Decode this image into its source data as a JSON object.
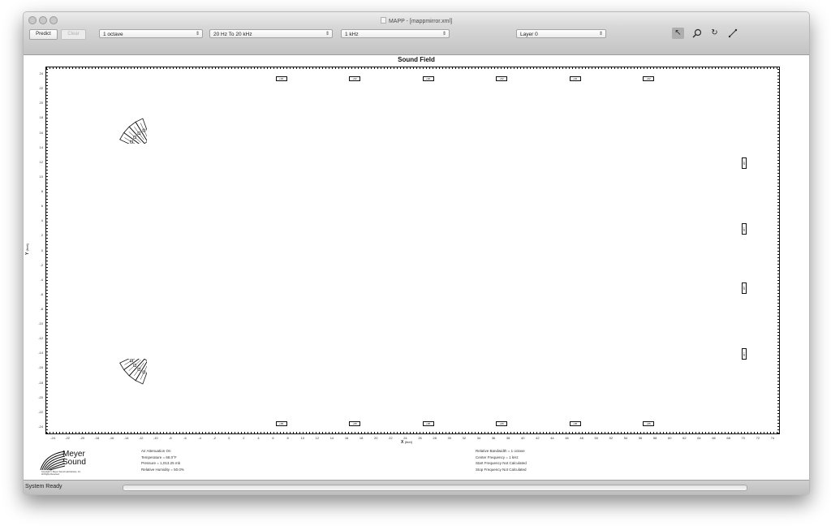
{
  "window": {
    "title": "MAPP - [mappmirror.xml]"
  },
  "toolbar": {
    "predict_label": "Predict",
    "clear_label": "Clear",
    "bandwidth_value": "1 octave",
    "range_value": "20 Hz To 20 kHz",
    "frequency_value": "1 kHz",
    "layer_value": "Layer 0",
    "tools": [
      "pointer-icon",
      "zoom-icon",
      "rotate-icon",
      "measure-icon"
    ]
  },
  "plot": {
    "title": "Sound Field",
    "x_axis_label": "X",
    "x_axis_unit": "(feet)",
    "y_axis_label": "Y",
    "y_axis_unit": "(feet)",
    "x_ticks": [
      "-24",
      "-22",
      "-20",
      "-18",
      "-16",
      "-14",
      "-12",
      "-10",
      "-8",
      "-6",
      "-4",
      "-2",
      "0",
      "2",
      "4",
      "6",
      "8",
      "10",
      "12",
      "14",
      "16",
      "18",
      "20",
      "22",
      "24",
      "26",
      "28",
      "30",
      "32",
      "34",
      "36",
      "38",
      "40",
      "42",
      "44",
      "46",
      "48",
      "50",
      "52",
      "54",
      "56",
      "58",
      "60",
      "62",
      "64",
      "66",
      "68",
      "70",
      "72",
      "74"
    ],
    "y_ticks": [
      "24",
      "22",
      "20",
      "18",
      "16",
      "14",
      "12",
      "10",
      "8",
      "6",
      "4",
      "2",
      "0",
      "-2",
      "-4",
      "-6",
      "-8",
      "-10",
      "-12",
      "-14",
      "-16",
      "-18",
      "-20",
      "-22",
      "-24"
    ],
    "xlim": [
      -25,
      75
    ],
    "ylim": [
      -25,
      25
    ],
    "top_row_speakers": [
      {
        "label": "+92",
        "x": 7
      },
      {
        "label": "+92",
        "x": 17
      },
      {
        "label": "+92",
        "x": 27
      },
      {
        "label": "+92",
        "x": 37
      },
      {
        "label": "+92",
        "x": 47
      },
      {
        "label": "+92",
        "x": 57
      }
    ],
    "bottom_row_speakers": [
      {
        "label": "+95",
        "x": 7
      },
      {
        "label": "+95",
        "x": 17
      },
      {
        "label": "+95",
        "x": 27
      },
      {
        "label": "+95",
        "x": 37
      },
      {
        "label": "+95",
        "x": 47
      },
      {
        "label": "+95",
        "x": 57
      }
    ],
    "right_column_speakers": [
      {
        "label": "+92",
        "y": 12
      },
      {
        "label": "+92",
        "y": 3
      },
      {
        "label": "+92",
        "y": -5
      },
      {
        "label": "+92",
        "y": -14
      }
    ],
    "arrays": [
      {
        "x": -14,
        "y": 17
      },
      {
        "x": -14,
        "y": -17
      }
    ]
  },
  "logo": {
    "brand_line1": "Meyer",
    "brand_line2": "Sound",
    "copyright_line1": "Copyright © Meyer Sound Laboratories, Inc.",
    "copyright_line2": "All Rights Reserved"
  },
  "conditions": {
    "air_attenuation": "Air Attenuation On",
    "temperature": "Temperature = 68.0°F",
    "pressure": "Pressure = 1,013.25 mb",
    "humidity": "Relative Humidity = 50.0%"
  },
  "frequency_info": {
    "bandwidth": "Relative Bandwidth = 1 octave",
    "center": "Center Frequency = 1 kHz",
    "start": "Start Frequency Not Calculated",
    "stop": "Stop Frequency Not Calculated"
  },
  "status": {
    "text": "System Ready",
    "progress": 0
  },
  "colors": {
    "toolbar": "#c9c9c9",
    "status": "#c6c6c6",
    "plot_line": "#111111"
  }
}
